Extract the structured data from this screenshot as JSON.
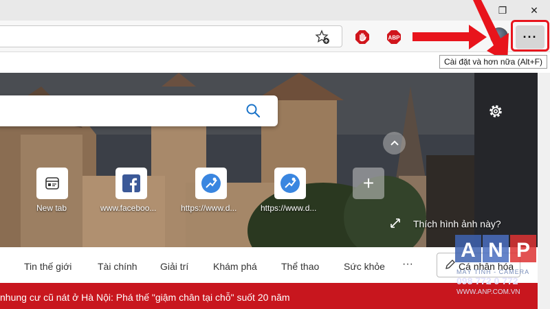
{
  "window": {
    "restore_glyph": "❐",
    "close_glyph": "✕"
  },
  "toolbar": {
    "abp_label": "ABP",
    "menu_glyph": "···",
    "menu_tooltip": "Cài đặt và hơn nữa (Alt+F)"
  },
  "tiles": [
    {
      "label": "New tab",
      "icon": "newtab-icon"
    },
    {
      "label": "www.faceboo...",
      "icon": "facebook-icon"
    },
    {
      "label": "https://www.d...",
      "icon": "site-icon"
    },
    {
      "label": "https://www.d...",
      "icon": "site-icon"
    }
  ],
  "hero": {
    "add_tile_glyph": "+",
    "like_image_text": "Thích hình ảnh này?"
  },
  "nav": {
    "items": [
      "Tin thế giới",
      "Tài chính",
      "Giải trí",
      "Khám phá",
      "Thể thao",
      "Sức khỏe"
    ],
    "more_glyph": "···",
    "personalize_label": "Cá nhân hóa"
  },
  "ticker": {
    "text": "nhung cư cũ nát ở Hà Nội: Phá thế \"giậm chân tại chỗ\" suốt 20 năm"
  },
  "watermark": {
    "brand_letters": [
      "A",
      "N",
      "P"
    ],
    "line1": "MÁY TÍNH - CAMERA",
    "phone": "098 772 0 772",
    "site": "WWW.ANP.COM.VN"
  },
  "colors": {
    "highlight_red": "#e8141c",
    "ticker_red": "#c8161e",
    "search_blue": "#1a73c8"
  }
}
